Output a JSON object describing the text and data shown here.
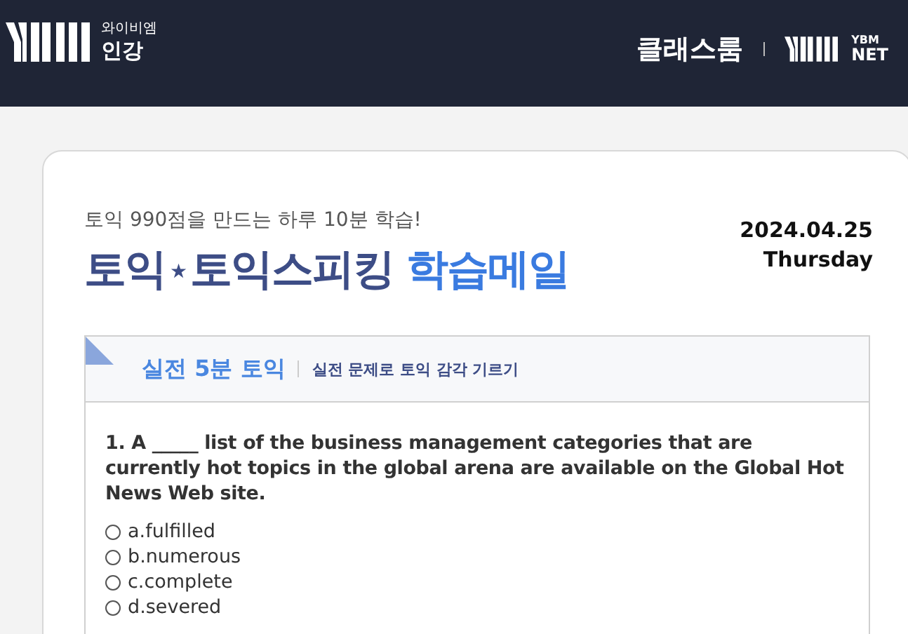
{
  "header": {
    "brand_top": "와이비엠",
    "brand_bottom": "인강",
    "classroom_link": "클래스룸",
    "net_top": "YBM",
    "net_bottom": "NET"
  },
  "mail": {
    "subtitle": "토익 990점을 만드는 하루 10분 학습!",
    "title_a": "토익",
    "title_star": "★",
    "title_b": "토익스피킹",
    "title_accent": "학습메일",
    "date": "2024.04.25",
    "weekday": "Thursday"
  },
  "section": {
    "title": "실전 5분 토익",
    "subtitle": "실전 문제로 토익 감각 기르기",
    "question": "1. A _____ list of the business management categories that are currently hot topics in the global arena are available on the Global Hot News Web site.",
    "options": [
      {
        "label": "a.fulfilled",
        "selected": false
      },
      {
        "label": "b.numerous",
        "selected": false
      },
      {
        "label": "c.complete",
        "selected": false
      },
      {
        "label": "d.severed",
        "selected": false
      }
    ]
  }
}
